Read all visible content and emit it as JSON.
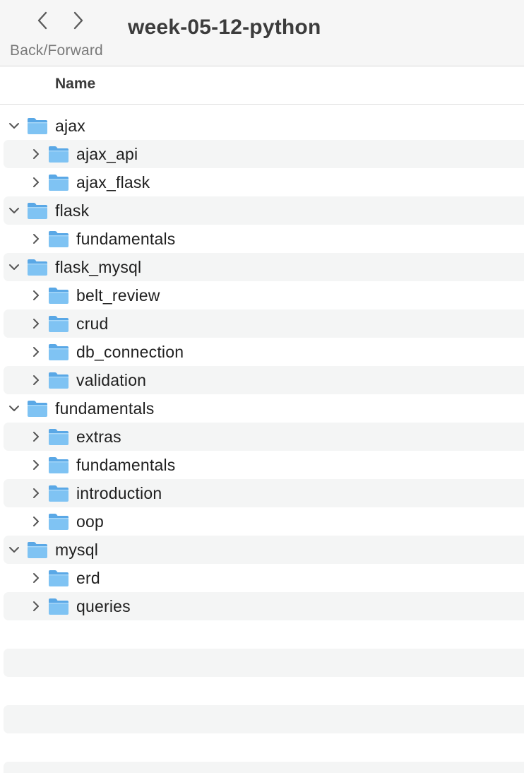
{
  "toolbar": {
    "nav_label": "Back/Forward",
    "back_icon": "chevron-left-icon",
    "forward_icon": "chevron-right-icon",
    "title": "week-05-12-python"
  },
  "columns": {
    "name": "Name"
  },
  "colors": {
    "folder_body": "#7fc3f3",
    "folder_tab": "#5aa8e6",
    "stripe": "#f4f5f5",
    "chevron": "#555555"
  },
  "rows": [
    {
      "label": "ajax",
      "level": 0,
      "expanded": true
    },
    {
      "label": "ajax_api",
      "level": 1,
      "expanded": false
    },
    {
      "label": "ajax_flask",
      "level": 1,
      "expanded": false
    },
    {
      "label": "flask",
      "level": 0,
      "expanded": true
    },
    {
      "label": "fundamentals",
      "level": 1,
      "expanded": false
    },
    {
      "label": "flask_mysql",
      "level": 0,
      "expanded": true
    },
    {
      "label": "belt_review",
      "level": 1,
      "expanded": false
    },
    {
      "label": "crud",
      "level": 1,
      "expanded": false
    },
    {
      "label": "db_connection",
      "level": 1,
      "expanded": false
    },
    {
      "label": "validation",
      "level": 1,
      "expanded": false
    },
    {
      "label": "fundamentals",
      "level": 0,
      "expanded": true
    },
    {
      "label": "extras",
      "level": 1,
      "expanded": false
    },
    {
      "label": "fundamentals",
      "level": 1,
      "expanded": false
    },
    {
      "label": "introduction",
      "level": 1,
      "expanded": false
    },
    {
      "label": "oop",
      "level": 1,
      "expanded": false
    },
    {
      "label": "mysql",
      "level": 0,
      "expanded": true
    },
    {
      "label": "erd",
      "level": 1,
      "expanded": false
    },
    {
      "label": "queries",
      "level": 1,
      "expanded": false
    }
  ],
  "empty_rows": 6
}
